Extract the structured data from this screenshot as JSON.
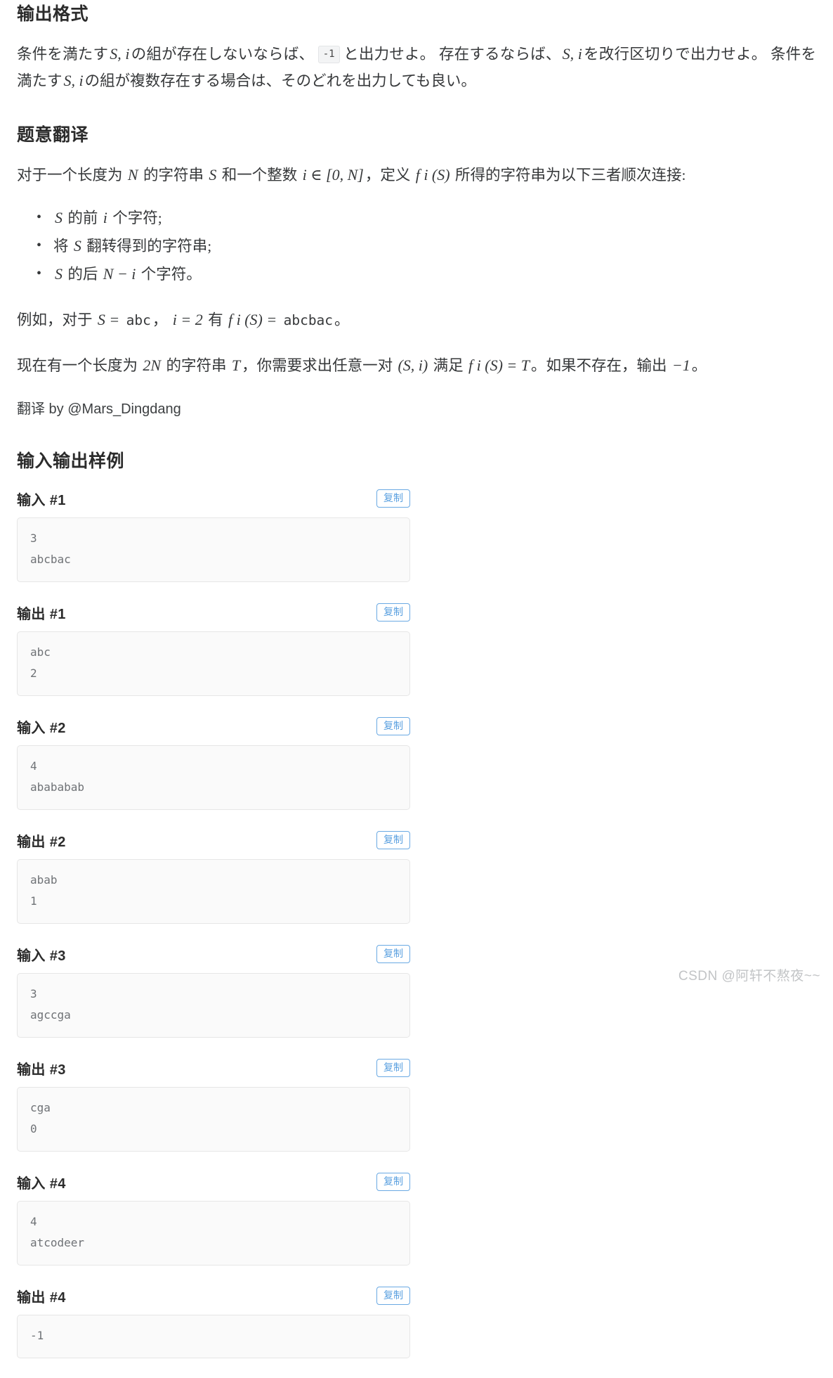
{
  "sections": {
    "output_format": {
      "heading": "输出格式",
      "paragraph_pre": "条件を満たす",
      "math_Si_1": "S, i",
      "paragraph_mid1": "の組が存在しないならば、",
      "inline_code": "-1",
      "paragraph_mid2": "と出力せよ。 存在するならば、",
      "math_Si_2": "S, i",
      "paragraph_mid3": "を改行区切りで出力せよ。 条件を満たす",
      "math_Si_3": "S, i",
      "paragraph_end": "の組が複数存在する場合は、そのどれを出力しても良い。"
    },
    "translation": {
      "heading": "题意翻译",
      "intro_p1": "对于一个长度为",
      "math_N": "N",
      "intro_p2": "的字符串",
      "math_S": "S",
      "intro_p3": "和一个整数",
      "math_i_in": "i ∈ [0, N]",
      "intro_p4": "，定义",
      "math_fiS": "f i (S)",
      "intro_p5": "所得的字符串为以下三者顺次连接:",
      "bullets": [
        {
          "pre": "",
          "math_a": "S",
          "mid": "的前",
          "math_b": "i",
          "post": "个字符;"
        },
        {
          "pre": "将",
          "math_a": "S",
          "mid": "翻转得到的字符串;",
          "math_b": "",
          "post": ""
        },
        {
          "pre": "",
          "math_a": "S",
          "mid": "的后",
          "math_b": "N − i",
          "post": "个字符。"
        }
      ],
      "example_p1": "例如，对于",
      "example_m1": "S =",
      "example_m1b": "abc",
      "example_p2": "，",
      "example_m2": "i = 2",
      "example_p3": "有",
      "example_m3": "f i (S) =",
      "example_m3b": "abcbac",
      "example_p4": "。",
      "problem_p1": "现在有一个长度为",
      "problem_m1": "2N",
      "problem_p2": "的字符串",
      "problem_m2": "T",
      "problem_p3": "，你需要求出任意一对",
      "problem_m3": "(S, i)",
      "problem_p4": "满足",
      "problem_m4": "f i (S) = T",
      "problem_p5": "。如果不存在，输出",
      "problem_m5": "−1",
      "problem_p6": "。",
      "translator_credit": "翻译 by @Mars_Dingdang"
    },
    "samples": {
      "heading": "输入输出样例",
      "copy_label": "复制",
      "items": [
        {
          "title": "输入 #1",
          "content": "3\nabcbac"
        },
        {
          "title": "输出 #1",
          "content": "abc\n2"
        },
        {
          "title": "输入 #2",
          "content": "4\nabababab"
        },
        {
          "title": "输出 #2",
          "content": "abab\n1"
        },
        {
          "title": "输入 #3",
          "content": "3\nagccga"
        },
        {
          "title": "输出 #3",
          "content": "cga\n0"
        },
        {
          "title": "输入 #4",
          "content": "4\natcodeer"
        },
        {
          "title": "输出 #4",
          "content": "-1"
        }
      ]
    }
  },
  "watermark": "CSDN @阿轩不熬夜~~",
  "colors": {
    "accent": "#6aa9e3",
    "text": "#36383a",
    "heading": "#2b2b2b",
    "box_bg": "#fafafa",
    "box_border": "#e6e6e6",
    "code_text": "#6f7276"
  }
}
